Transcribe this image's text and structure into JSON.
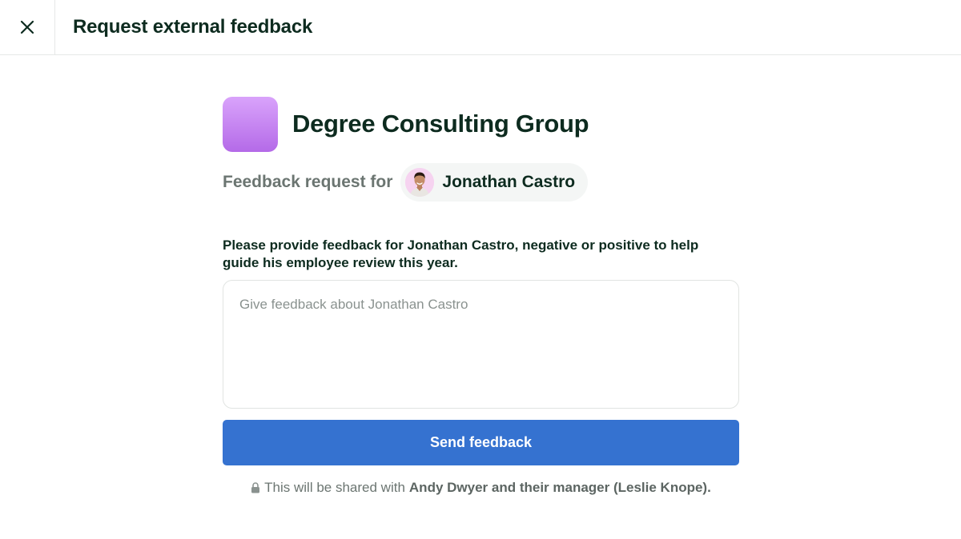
{
  "header": {
    "title": "Request external feedback",
    "close_icon": "close-icon"
  },
  "organization": {
    "name": "Degree Consulting Group",
    "logo_gradient": [
      "#d9a3fb",
      "#b46ae8"
    ]
  },
  "request": {
    "label": "Feedback request for",
    "person_name": "Jonathan Castro",
    "avatar_icon": "avatar"
  },
  "prompt": "Please provide feedback for Jonathan Castro, negative or positive to help guide his employee review this year.",
  "feedback_input": {
    "placeholder": "Give feedback about Jonathan Castro",
    "value": ""
  },
  "send_button": {
    "label": "Send feedback",
    "color": "#3572d0"
  },
  "share_note": {
    "icon": "lock-icon",
    "prefix": "This will be shared with",
    "emphasis": "Andy Dwyer and their manager (Leslie Knope)."
  }
}
